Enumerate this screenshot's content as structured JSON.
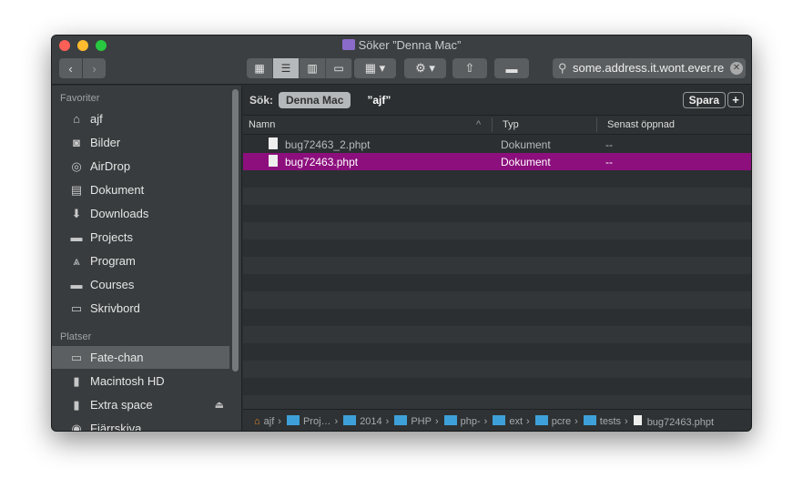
{
  "window": {
    "title": "Söker ”Denna Mac”"
  },
  "toolbar": {
    "back": "‹",
    "forward": "›",
    "search_value": "some.address.it.wont.ever.re"
  },
  "sidebar": {
    "favorites_label": "Favoriter",
    "favorites": [
      {
        "label": "ajf",
        "icon": "home-icon"
      },
      {
        "label": "Bilder",
        "icon": "camera-icon"
      },
      {
        "label": "AirDrop",
        "icon": "airdrop-icon"
      },
      {
        "label": "Dokument",
        "icon": "document-icon"
      },
      {
        "label": "Downloads",
        "icon": "download-icon"
      },
      {
        "label": "Projects",
        "icon": "folder-icon"
      },
      {
        "label": "Program",
        "icon": "apps-icon"
      },
      {
        "label": "Courses",
        "icon": "folder-icon"
      },
      {
        "label": "Skrivbord",
        "icon": "desktop-icon"
      }
    ],
    "places_label": "Platser",
    "places": [
      {
        "label": "Fate-chan",
        "icon": "laptop-icon",
        "selected": true
      },
      {
        "label": "Macintosh HD",
        "icon": "disk-icon"
      },
      {
        "label": "Extra space",
        "icon": "disk-icon"
      },
      {
        "label": "Fjärrskiva",
        "icon": "disc-icon"
      }
    ]
  },
  "searchbar": {
    "label": "Sök:",
    "scope": "Denna Mac",
    "query": "”ajf”",
    "save": "Spara",
    "add": "+"
  },
  "columns": [
    "Namn",
    "Typ",
    "Senast öppnad"
  ],
  "files": [
    {
      "name": "bug72463_2.phpt",
      "type": "Dokument",
      "opened": "--"
    },
    {
      "name": "bug72463.phpt",
      "type": "Dokument",
      "opened": "--",
      "selected": true
    }
  ],
  "path": [
    "ajf",
    "Proj…",
    "2014",
    "PHP",
    "php-",
    "ext",
    "pcre",
    "tests",
    "bug72463.phpt"
  ],
  "colors": {
    "selection": "#8c0f7d",
    "folder": "#3ea0d8"
  }
}
